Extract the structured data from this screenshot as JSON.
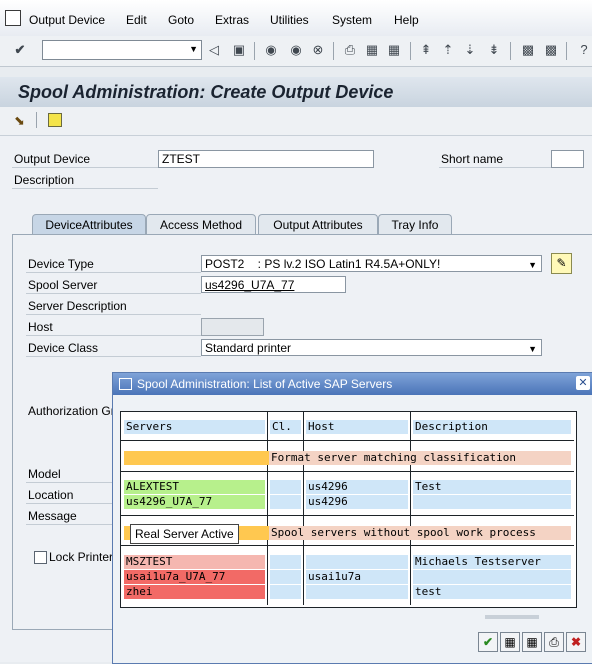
{
  "menu": [
    "Output Device",
    "Edit",
    "Goto",
    "Extras",
    "Utilities",
    "System",
    "Help"
  ],
  "title": "Spool Administration: Create Output Device",
  "form": {
    "output_device_label": "Output Device",
    "output_device_value": "ZTEST",
    "short_name_label": "Short name",
    "description_label": "Description"
  },
  "tabs": [
    "DeviceAttributes",
    "Access Method",
    "Output Attributes",
    "Tray Info"
  ],
  "device": {
    "device_type_label": "Device Type",
    "device_type_value": "POST2    : PS lv.2 ISO Latin1 R4.5A+ONLY!",
    "spool_server_label": "Spool Server",
    "spool_server_value": "us4296_U7A_77",
    "server_description_label": "Server Description",
    "host_label": "Host",
    "device_class_label": "Device Class",
    "device_class_value": "Standard printer",
    "authorization_label": "Authorization Gr",
    "model_label": "Model",
    "location_label": "Location",
    "message_label": "Message",
    "lock_printer_label": "Lock Printer"
  },
  "dialog": {
    "title": "Spool Administration: List of Active SAP Servers",
    "headers": [
      "Servers",
      "Cl.",
      "Host",
      "Description"
    ],
    "group1_label": "Format server matching classification",
    "group1_rows": [
      {
        "server": "ALEXTEST",
        "host": "us4296",
        "description": "Test"
      },
      {
        "server": "us4296_U7A_77",
        "host": "us4296",
        "description": ""
      }
    ],
    "group2_label": "Spool servers without spool work process",
    "group2_rows": [
      {
        "server": "MSZTEST",
        "host": "",
        "description": "Michaels Testserver"
      },
      {
        "server": "usai1u7a_U7A_77",
        "host": "usai1u7a",
        "description": ""
      },
      {
        "server": "zhei",
        "host": "",
        "description": "test"
      }
    ],
    "tooltip": "Real Server Active"
  },
  "colors": {
    "server_active": "#b7f08c",
    "server_inactive_light": "#f5b7b0",
    "server_inactive": "#f26a66",
    "group_header_left": "#ffc850",
    "group_header_right": "#f4d3c4",
    "cell_blue": "#cfe6f8"
  }
}
